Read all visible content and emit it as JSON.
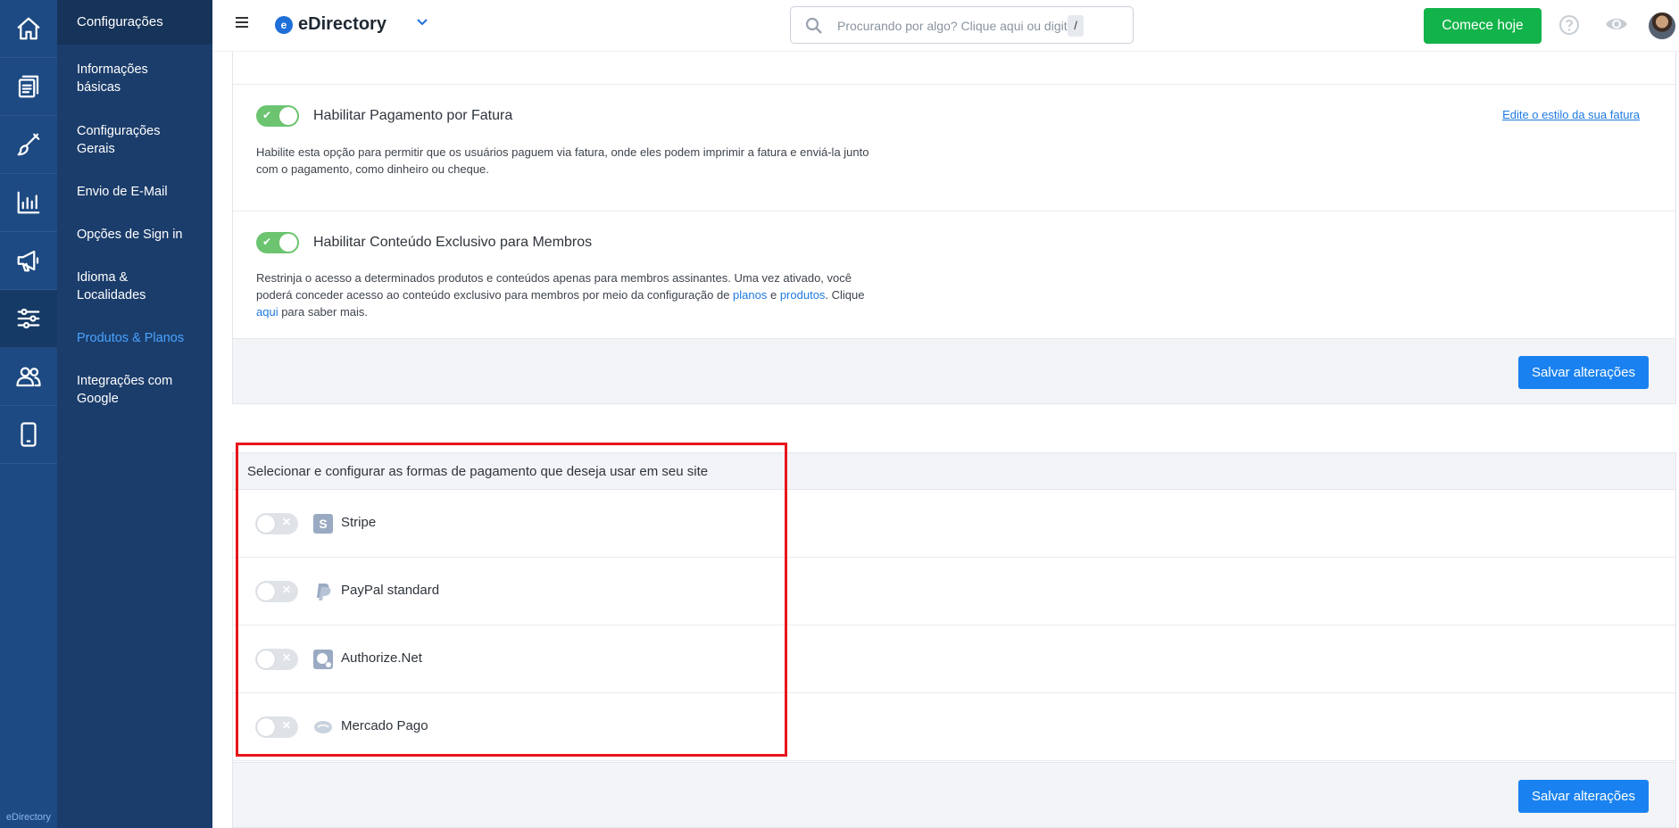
{
  "rail": {
    "items": [
      {
        "icon": "home-icon"
      },
      {
        "icon": "content-icon"
      },
      {
        "icon": "design-brush-icon"
      },
      {
        "icon": "reports-chart-icon"
      },
      {
        "icon": "promote-megaphone-icon"
      },
      {
        "icon": "settings-sliders-icon"
      },
      {
        "icon": "users-icon"
      },
      {
        "icon": "mobile-icon"
      }
    ],
    "footer": "eDirectory"
  },
  "submenu": {
    "title": "Configurações",
    "items": [
      "Informações básicas",
      "Configurações Gerais",
      "Envio de E-Mail",
      "Opções de Sign in",
      "Idioma & Localidades",
      "Produtos & Planos",
      "Integrações com Google"
    ],
    "active_index": 5
  },
  "topbar": {
    "logo_letter": "e",
    "logo_text": "eDirectory",
    "search_placeholder": "Procurando por algo? Clique aqui ou digite",
    "search_shortcut": "/",
    "cta_label": "Comece hoje"
  },
  "settings": {
    "invoice": {
      "title": "Habilitar Pagamento por Fatura",
      "description": "Habilite esta opção para permitir que os usuários paguem via fatura, onde eles podem imprimir a fatura e enviá-la junto com o pagamento, como dinheiro ou cheque.",
      "link": "Edite o estilo da sua fatura",
      "enabled": true
    },
    "members": {
      "title": "Habilitar Conteúdo Exclusivo para Membros",
      "desc_part1": "Restrinja o acesso a determinados produtos e conteúdos apenas para membros assinantes. Uma vez ativado, você poderá conceder acesso ao conteúdo exclusivo para membros por meio da configuração de ",
      "link_plans": "planos",
      "desc_part2": " e ",
      "link_products": "produtos",
      "desc_part3": ". Clique ",
      "link_here": "aqui",
      "desc_part4": " para saber mais.",
      "enabled": true
    },
    "save_label": "Salvar alterações"
  },
  "payments": {
    "heading": "Selecionar e configurar as formas de pagamento que deseja usar em seu site",
    "methods": [
      {
        "label": "Stripe",
        "icon": "stripe-icon",
        "enabled": false
      },
      {
        "label": "PayPal standard",
        "icon": "paypal-icon",
        "enabled": false
      },
      {
        "label": "Authorize.Net",
        "icon": "authorize-net-icon",
        "enabled": false
      },
      {
        "label": "Mercado Pago",
        "icon": "mercado-pago-icon",
        "enabled": false
      }
    ],
    "save_label": "Salvar alterações"
  },
  "colors": {
    "rail": "#1d4a82",
    "submenu": "#1b3d6b",
    "accent_blue": "#1a82f0",
    "cta_green": "#12b34a",
    "toggle_on": "#6cc470",
    "highlight_red": "#e8161c"
  }
}
